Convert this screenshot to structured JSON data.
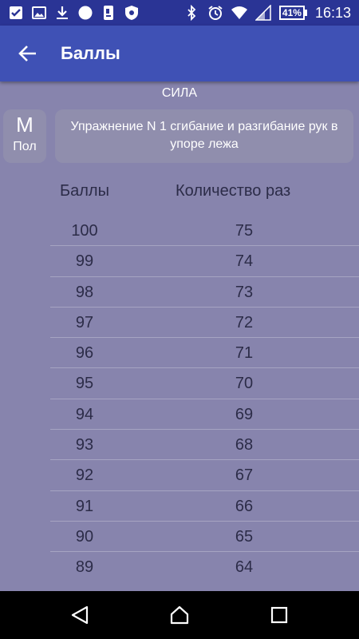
{
  "status_bar": {
    "battery": "41%",
    "time": "16:13"
  },
  "app_bar": {
    "title": "Баллы"
  },
  "section": {
    "title": "СИЛА"
  },
  "gender": {
    "letter": "М",
    "label": "Пол"
  },
  "exercise": {
    "text": "Упражнение N 1 сгибание и разгибание рук в упоре лежа"
  },
  "table": {
    "headers": {
      "score": "Баллы",
      "count": "Количество раз"
    },
    "rows": [
      {
        "score": "100",
        "count": "75"
      },
      {
        "score": "99",
        "count": "74"
      },
      {
        "score": "98",
        "count": "73"
      },
      {
        "score": "97",
        "count": "72"
      },
      {
        "score": "96",
        "count": "71"
      },
      {
        "score": "95",
        "count": "70"
      },
      {
        "score": "94",
        "count": "69"
      },
      {
        "score": "93",
        "count": "68"
      },
      {
        "score": "92",
        "count": "67"
      },
      {
        "score": "91",
        "count": "66"
      },
      {
        "score": "90",
        "count": "65"
      },
      {
        "score": "89",
        "count": "64"
      }
    ]
  },
  "colors": {
    "status_bar": "#2a3495",
    "app_bar": "#3f51b5",
    "background": "#8784ad"
  }
}
